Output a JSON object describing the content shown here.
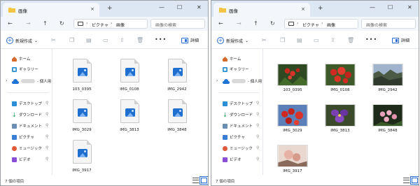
{
  "windows": [
    {
      "tab_title": "画像",
      "tab_close": "×",
      "new_tab": "+",
      "controls": {
        "minimize": "—",
        "maximize": "☐",
        "close": "✕"
      },
      "nav": {
        "back": "←",
        "forward": "→",
        "up": "↑",
        "refresh": "↻"
      },
      "breadcrumb": {
        "sep": "›",
        "pictures": "ピクチャ",
        "current": "画像"
      },
      "search_placeholder": "画像の検索",
      "command": {
        "new_label": "新規作成",
        "new_caret": "⌄",
        "more": "•••",
        "details_label": "詳細"
      },
      "nav_items": [
        {
          "label": "ホーム",
          "icon": "home-icon"
        },
        {
          "label": "ギャラリー",
          "icon": "gallery-icon"
        },
        {
          "label": "- 個人用",
          "icon": "onedrive-icon"
        },
        {
          "label": "デスクトップ",
          "icon": "desktop-icon"
        },
        {
          "label": "ダウンロード",
          "icon": "download-icon"
        },
        {
          "label": "ドキュメント",
          "icon": "documents-icon"
        },
        {
          "label": "ピクチャ",
          "icon": "pictures-icon"
        },
        {
          "label": "ミュージック",
          "icon": "music-icon"
        },
        {
          "label": "ビデオ",
          "icon": "videos-icon"
        }
      ],
      "files": [
        {
          "name": "103_0395"
        },
        {
          "name": "IMG_0108"
        },
        {
          "name": "IMG_2942"
        },
        {
          "name": "IMG_3029"
        },
        {
          "name": "IMG_3813"
        },
        {
          "name": "IMG_3848"
        },
        {
          "name": "IMG_3917"
        }
      ],
      "status": "7 個の項目"
    },
    {
      "tab_title": "画像",
      "tab_close": "×",
      "new_tab": "+",
      "controls": {
        "minimize": "—",
        "maximize": "☐",
        "close": "✕"
      },
      "nav": {
        "back": "←",
        "forward": "→",
        "up": "↑",
        "refresh": "↻"
      },
      "breadcrumb": {
        "sep": "›",
        "pictures": "ピクチャ",
        "current": "画像"
      },
      "search_placeholder": "画像の検索",
      "command": {
        "new_label": "新規作成",
        "new_caret": "⌄",
        "more": "•••",
        "details_label": "詳細"
      },
      "nav_items": [
        {
          "label": "ホーム",
          "icon": "home-icon"
        },
        {
          "label": "ギャラリー",
          "icon": "gallery-icon"
        },
        {
          "label": "- 個人用",
          "icon": "onedrive-icon"
        },
        {
          "label": "デスクトップ",
          "icon": "desktop-icon"
        },
        {
          "label": "ダウンロード",
          "icon": "download-icon"
        },
        {
          "label": "ドキュメント",
          "icon": "documents-icon"
        },
        {
          "label": "ピクチャ",
          "icon": "pictures-icon"
        },
        {
          "label": "ミュージック",
          "icon": "music-icon"
        },
        {
          "label": "ビデオ",
          "icon": "videos-icon"
        }
      ],
      "files": [
        {
          "name": "103_0395"
        },
        {
          "name": "IMG_0108"
        },
        {
          "name": "IMG_2942"
        },
        {
          "name": "IMG_3029"
        },
        {
          "name": "IMG_3813"
        },
        {
          "name": "IMG_3848"
        },
        {
          "name": "IMG_3917"
        }
      ],
      "status": "7 個の項目"
    }
  ],
  "colors": {
    "titlebar": "#dde7f4",
    "accent": "#2b6fd6",
    "file_icon": "#1f6fd0",
    "folder": "#f4c542"
  }
}
